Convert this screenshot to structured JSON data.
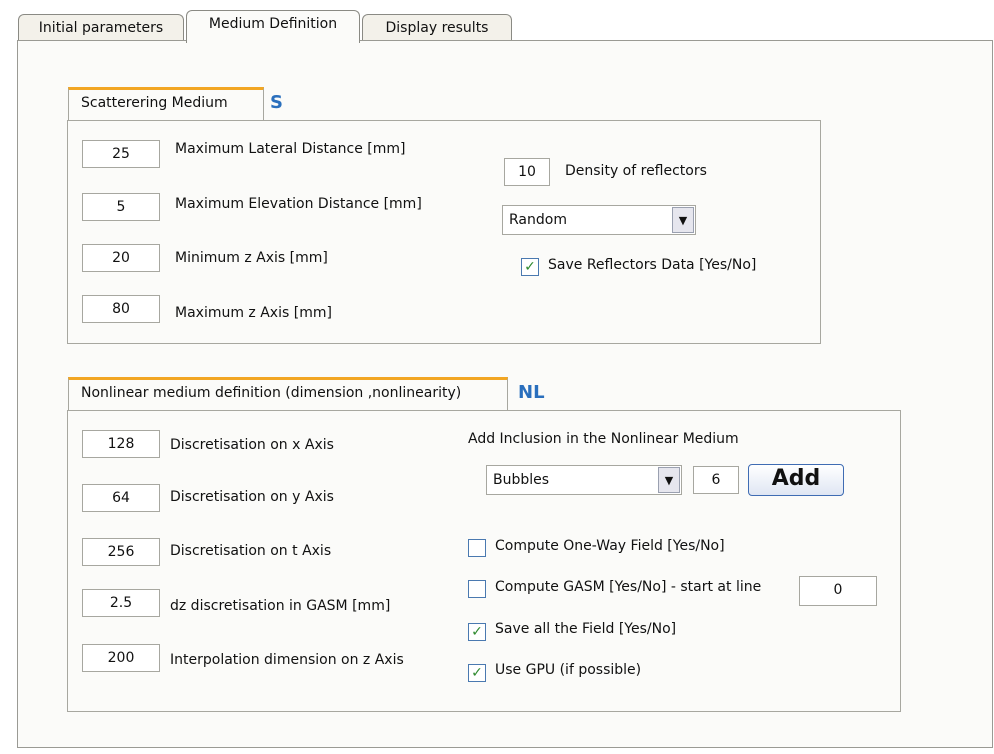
{
  "tabs": [
    {
      "label": "Initial parameters"
    },
    {
      "label": "Medium Definition"
    },
    {
      "label": "Display results"
    }
  ],
  "scattering": {
    "title": "Scatterering Medium",
    "tag": "S",
    "fields": [
      {
        "value": "25",
        "label": "Maximum Lateral Distance [mm]"
      },
      {
        "value": "5",
        "label": "Maximum Elevation Distance [mm]"
      },
      {
        "value": "20",
        "label": "Minimum z Axis [mm]"
      },
      {
        "value": "80",
        "label": "Maximum z Axis [mm]"
      }
    ],
    "density": {
      "value": "10",
      "label": "Density of reflectors"
    },
    "distribution": {
      "selected": "Random"
    },
    "save_reflectors": {
      "label": "Save Reflectors Data [Yes/No]",
      "checked": true
    }
  },
  "nonlinear": {
    "title": "Nonlinear medium definition (dimension ,nonlinearity)",
    "tag": "NL",
    "fields": [
      {
        "value": "128",
        "label": "Discretisation on x Axis"
      },
      {
        "value": "64",
        "label": "Discretisation on y Axis"
      },
      {
        "value": "256",
        "label": "Discretisation on t Axis"
      },
      {
        "value": "2.5",
        "label": "dz discretisation in GASM [mm]"
      },
      {
        "value": "200",
        "label": "Interpolation dimension on z Axis"
      }
    ],
    "inclusion_title": "Add Inclusion in the Nonlinear Medium",
    "inclusion_type": "Bubbles",
    "inclusion_count": "6",
    "add_label": "Add",
    "options": [
      {
        "label": "Compute One-Way Field [Yes/No]",
        "checked": false
      },
      {
        "label": "Compute GASM [Yes/No] - start at line",
        "checked": false
      },
      {
        "label": "Save all the Field [Yes/No]",
        "checked": true
      },
      {
        "label": "Use GPU (if possible)",
        "checked": true
      }
    ],
    "gasm_start_line": "0"
  }
}
